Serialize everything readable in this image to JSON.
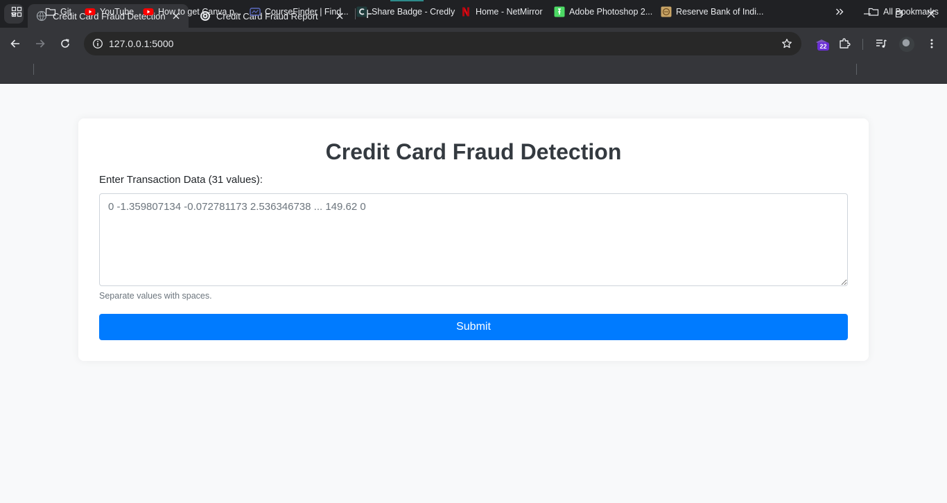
{
  "browser": {
    "tabs": [
      {
        "title": "Credit Card Fraud Detection",
        "active": true
      },
      {
        "title": "Credit Card Fraud Report",
        "active": false
      }
    ],
    "address_bar": {
      "url": "127.0.0.1:5000"
    },
    "extension_badge": "22",
    "bookmarks": [
      {
        "label": "Git",
        "icon": "folder-icon"
      },
      {
        "label": "YouTube",
        "icon": "youtube-icon"
      },
      {
        "label": "How to get Canva p...",
        "icon": "youtube-icon"
      },
      {
        "label": "CourseFinder | Find...",
        "icon": "coursefinder-icon"
      },
      {
        "label": "Share Badge - Credly",
        "icon": "credly-icon"
      },
      {
        "label": "Home - NetMirror",
        "icon": "netmirror-icon"
      },
      {
        "label": "Adobe Photoshop 2...",
        "icon": "photoshop-icon"
      },
      {
        "label": "Reserve Bank of Indi...",
        "icon": "rbi-icon"
      }
    ],
    "all_bookmarks_label": "All Bookmarks"
  },
  "page": {
    "heading": "Credit Card Fraud Detection",
    "input_label": "Enter Transaction Data (31 values):",
    "textarea_placeholder": "0 -1.359807134 -0.072781173 2.536346738 ... 149.62 0",
    "help_text": "Separate values with spaces.",
    "submit_label": "Submit"
  },
  "colors": {
    "primary": "#007bff",
    "page_background": "#f8f9fa",
    "heading_text": "#343a40",
    "chrome_dark": "#202124",
    "chrome_toolbar": "#35363a"
  }
}
